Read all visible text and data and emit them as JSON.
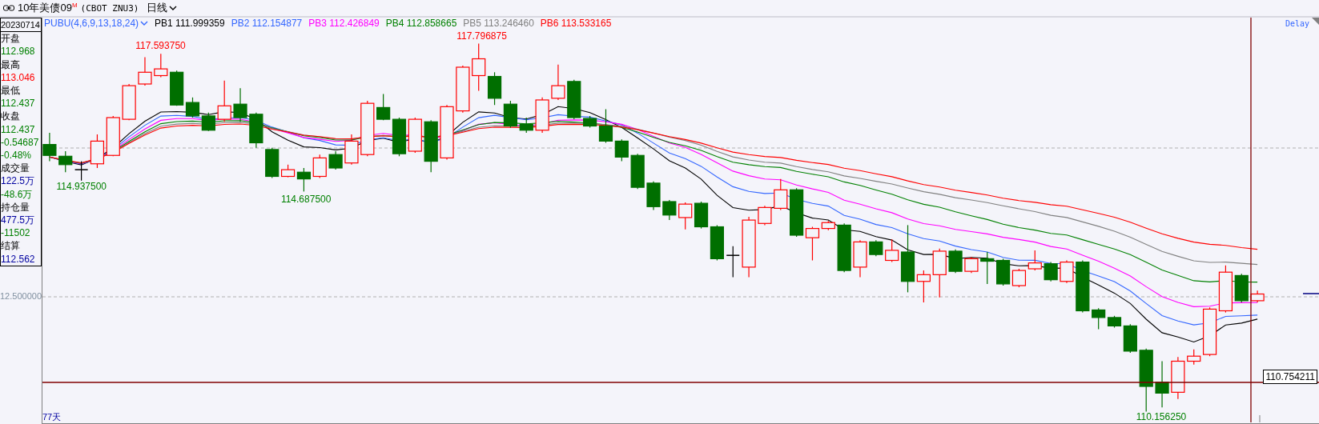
{
  "toolbar": {
    "symbol": "10年美债09$^{M}$",
    "exchange": "(CBOT ZNU3)",
    "period": "日线"
  },
  "info_panel": {
    "date": "20230714",
    "fields": [
      {
        "label": "开盘",
        "values": [
          {
            "text": "112.968",
            "color": "#008000"
          }
        ]
      },
      {
        "label": "最高",
        "values": [
          {
            "text": "113.046",
            "color": "#ff0000"
          }
        ]
      },
      {
        "label": "最低",
        "values": [
          {
            "text": "112.437",
            "color": "#008000"
          }
        ]
      },
      {
        "label": "收盘",
        "values": [
          {
            "text": "112.437",
            "color": "#008000"
          },
          {
            "text": "-0.54687",
            "color": "#008000"
          },
          {
            "text": "-0.48%",
            "color": "#008000"
          }
        ]
      },
      {
        "label": "成交量",
        "values": [
          {
            "text": "122.5万",
            "color": "#0000a0"
          },
          {
            "text": "-48.6万",
            "color": "#008000"
          }
        ]
      },
      {
        "label": "持仓量",
        "values": [
          {
            "text": "477.5万",
            "color": "#0000a0"
          },
          {
            "text": "-11502",
            "color": "#008000"
          }
        ]
      },
      {
        "label": "结算",
        "values": [
          {
            "text": "112.562",
            "color": "#0000a0"
          }
        ]
      }
    ]
  },
  "legend": {
    "indicator": "PUBU(4,6,9,13,18,24)",
    "lines": [
      {
        "text": "PB1 111.999359",
        "color": "#000000"
      },
      {
        "text": "PB2 112.154877",
        "color": "#3366ff"
      },
      {
        "text": "PB3 112.426849",
        "color": "#ff00ff"
      },
      {
        "text": "PB4 112.858665",
        "color": "#008000"
      },
      {
        "text": "PB5 113.246460",
        "color": "#808080"
      },
      {
        "text": "PB6 113.533165",
        "color": "#ff0000"
      }
    ]
  },
  "status": "Delay",
  "price_axis_label": "12.500000",
  "cursor_price": "110.754211",
  "annotations": [
    {
      "text": "117.593750",
      "kind": "high"
    },
    {
      "text": "117.796875",
      "kind": "high"
    },
    {
      "text": "114.937500",
      "kind": "low"
    },
    {
      "text": "114.687500",
      "kind": "low"
    },
    {
      "text": "110.156250",
      "kind": "low"
    }
  ],
  "day_count": "77天"
}
